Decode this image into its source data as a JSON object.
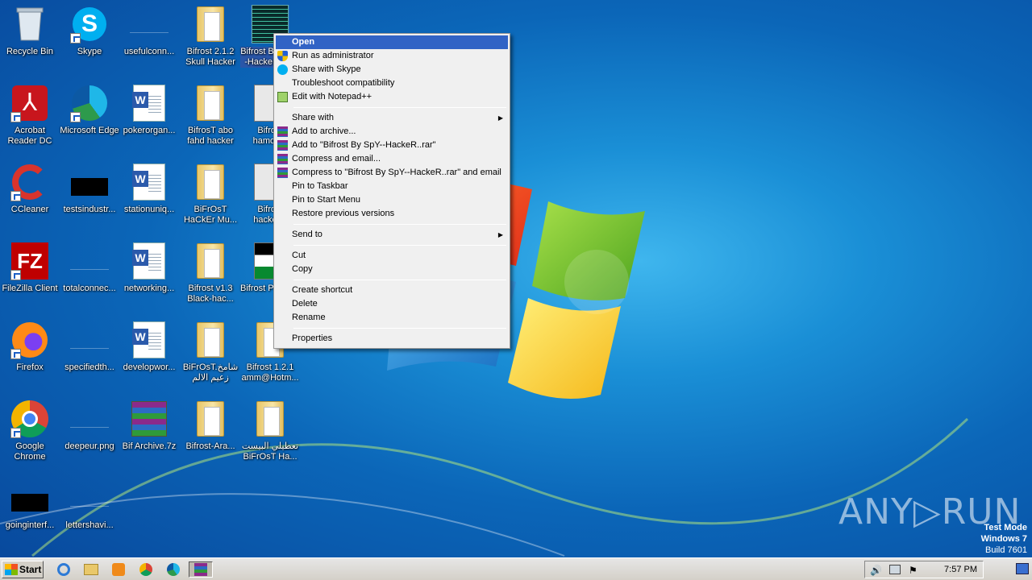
{
  "desktop": {
    "icons": [
      {
        "label": "Recycle Bin"
      },
      {
        "label": "Skype"
      },
      {
        "label": "usefulconn..."
      },
      {
        "label": "Bifrost 2.1.2 Skull Hacker"
      },
      {
        "label": "Bifrost By SpY--HackeR.exe"
      },
      {
        "label": "Acrobat Reader DC"
      },
      {
        "label": "Microsoft Edge"
      },
      {
        "label": "pokerorgan..."
      },
      {
        "label": "BifrosT abo fahd hacker"
      },
      {
        "label": "Bifrost hamoo..."
      },
      {
        "label": "CCleaner"
      },
      {
        "label": "testsindustr..."
      },
      {
        "label": "stationuniq..."
      },
      {
        "label": "BiFrOsT HaCkEr Mu..."
      },
      {
        "label": "Bifrost hacker..."
      },
      {
        "label": "FileZilla Client"
      },
      {
        "label": "totalconnec..."
      },
      {
        "label": "networking..."
      },
      {
        "label": "Bifrost v1.3 Black-hac..."
      },
      {
        "label": "Bifrost Palest..."
      },
      {
        "label": "Firefox"
      },
      {
        "label": "specifiedth..."
      },
      {
        "label": "developwor..."
      },
      {
        "label": "BiFrOsT.شامخ زعيم الالم"
      },
      {
        "label": "Bifrost 1.2.1 amm@Hotm..."
      },
      {
        "label": "Google Chrome"
      },
      {
        "label": "deepeur.png"
      },
      {
        "label": "Bif Archive.7z"
      },
      {
        "label": "Bifrost-Ara..."
      },
      {
        "label": "تعطيلي البيست BiFrOsT Ha..."
      },
      {
        "label": "goinginterf..."
      },
      {
        "label": "lettershavi..."
      }
    ]
  },
  "context_menu": {
    "open": "Open",
    "run_as_admin": "Run as administrator",
    "share_skype": "Share with Skype",
    "troubleshoot": "Troubleshoot compatibility",
    "edit_notepad": "Edit with Notepad++",
    "share_with": "Share with",
    "add_archive": "Add to archive...",
    "add_to_rar": "Add to \"Bifrost By SpY--HackeR..rar\"",
    "compress_email": "Compress and email...",
    "compress_rar_email": "Compress to \"Bifrost By SpY--HackeR..rar\" and email",
    "pin_taskbar": "Pin to Taskbar",
    "pin_start": "Pin to Start Menu",
    "restore": "Restore previous versions",
    "send_to": "Send to",
    "cut": "Cut",
    "copy": "Copy",
    "create_shortcut": "Create shortcut",
    "delete": "Delete",
    "rename": "Rename",
    "properties": "Properties"
  },
  "taskbar": {
    "start_label": "Start",
    "clock": "7:57 PM"
  },
  "watermark": {
    "brand": "ANY▷RUN",
    "mode": "Test Mode",
    "os": "Windows 7",
    "build": "Build 7601"
  },
  "colors": {
    "menu_highlight": "#3163c5",
    "selection": "#2a56a8"
  }
}
